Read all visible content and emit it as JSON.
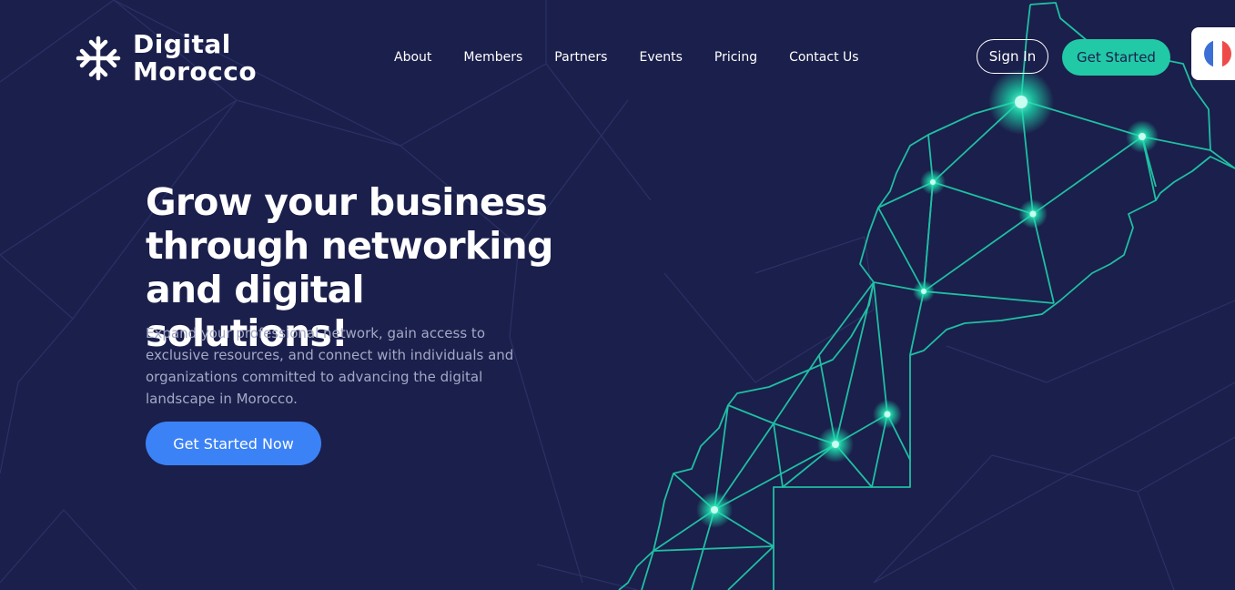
{
  "brand": {
    "line1": "Digital",
    "line2": "Morocco",
    "logo_icon": "snowflake-arrows-icon",
    "colors": {
      "background": "#1b1f4b",
      "accent": "#22c9a7",
      "cta": "#3b82f6"
    }
  },
  "nav": {
    "items": [
      {
        "label": "About"
      },
      {
        "label": "Members"
      },
      {
        "label": "Partners"
      },
      {
        "label": "Events"
      },
      {
        "label": "Pricing"
      },
      {
        "label": "Contact Us"
      }
    ],
    "sign_in": "Sign In",
    "get_started": "Get Started",
    "language_flag": "france-flag-icon"
  },
  "hero": {
    "title": "Grow your business through networking and digital solutions!",
    "description": "Expand your professional network, gain access to exclusive resources, and connect with individuals and organizations committed to advancing the digital landscape in Morocco.",
    "cta": "Get Started Now"
  }
}
